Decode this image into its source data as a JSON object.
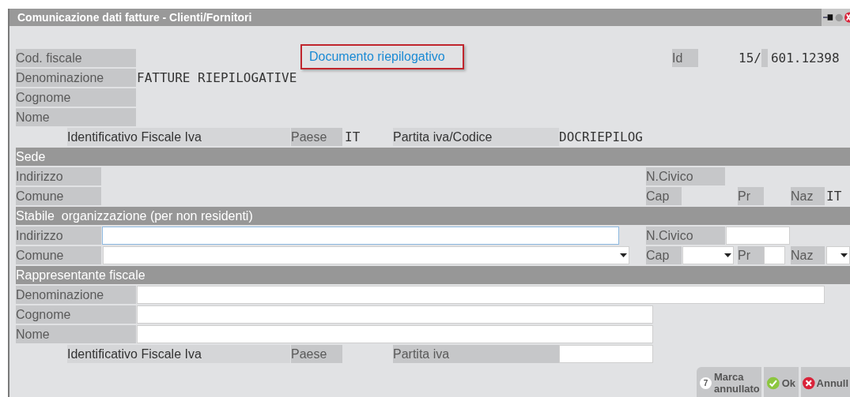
{
  "window": {
    "title": "Comunicazione dati fatture - Clienti/Fornitori"
  },
  "top": {
    "cod_fiscale_label": "Cod. fiscale",
    "summary_link": "Documento riepilogativo",
    "id_label": "Id",
    "id_prefix": "15/",
    "id_number": "601.12398",
    "denominazione_label": "Denominazione",
    "denominazione": "FATTURE RIEPILOGATIVE",
    "cognome_label": "Cognome",
    "nome_label": "Nome",
    "fiscal_id_label": "Identificativo Fiscale Iva",
    "country_label": "Paese",
    "country": "IT",
    "vat_label": "Partita iva/Codice",
    "vat": "DOCRIEPILOG"
  },
  "sede": {
    "title": "Sede",
    "address_label": "Indirizzo",
    "civic_label": "N.Civico",
    "city_label": "Comune",
    "zip_label": "Cap",
    "province_label": "Pr",
    "nation_label": "Naz",
    "nation": "IT"
  },
  "stabile": {
    "title": "Stabile  organizzazione (per non residenti)",
    "address_label": "Indirizzo",
    "address_focused": true,
    "civic_label": "N.Civico",
    "city_label": "Comune",
    "zip_label": "Cap",
    "province_label": "Pr",
    "nation_label": "Naz"
  },
  "rappresentante": {
    "title": "Rappresentante fiscale",
    "denominazione_label": "Denominazione",
    "cognome_label": "Cognome",
    "nome_label": "Nome",
    "fiscal_id_label": "Identificativo Fiscale Iva",
    "country_label": "Paese",
    "vat_label": "Partita iva"
  },
  "buttons": [
    {
      "kind": "mark",
      "key": "7",
      "label": "Marca annullato"
    },
    {
      "kind": "ok",
      "label": "Ok"
    },
    {
      "kind": "cancel",
      "label": "Annull"
    }
  ]
}
